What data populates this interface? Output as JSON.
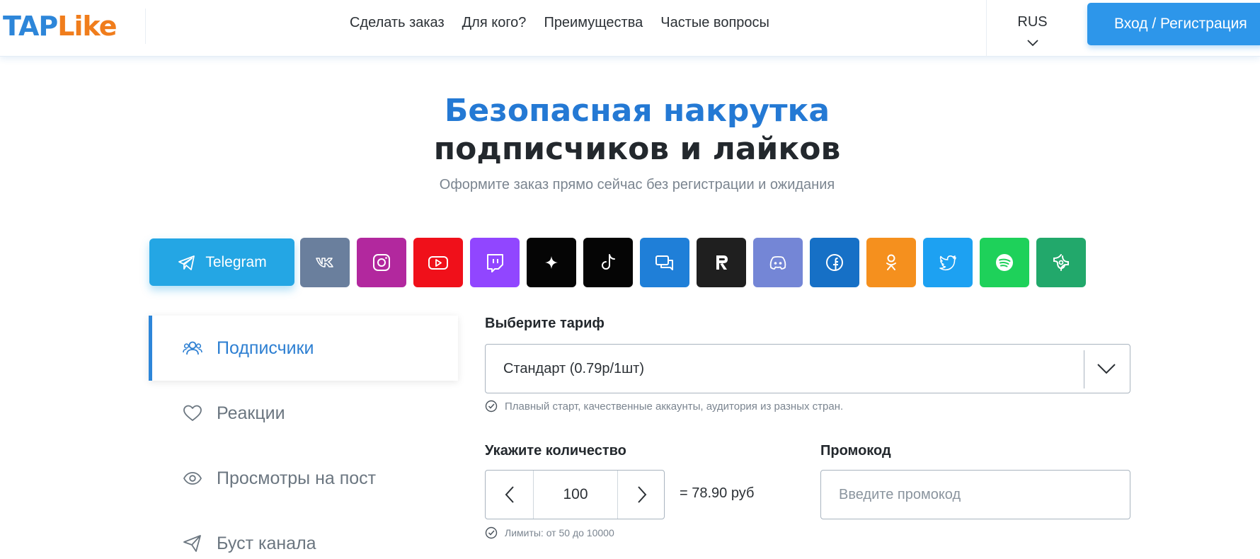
{
  "brand": {
    "part1": "TAP",
    "part2": "Like"
  },
  "nav": [
    {
      "label": "Сделать заказ"
    },
    {
      "label": "Для кого?"
    },
    {
      "label": "Преимущества"
    },
    {
      "label": "Частые вопросы"
    }
  ],
  "language": {
    "code": "RUS"
  },
  "login_button": "Вход / Регистрация",
  "hero": {
    "title_line1": "Безопасная накрутка",
    "title_line2": "подписчиков и лайков",
    "subtitle": "Оформите заказ прямо сейчас без регистрации и ожидания"
  },
  "platforms": [
    {
      "name": "Telegram",
      "icon": "telegram-icon",
      "color": "#24a6e4",
      "selected": true
    },
    {
      "name": "VK",
      "icon": "vk-icon",
      "color": "#6a7f9d"
    },
    {
      "name": "Instagram",
      "icon": "instagram-icon",
      "color": "#b2289e"
    },
    {
      "name": "YouTube",
      "icon": "youtube-icon",
      "color": "#f0101a"
    },
    {
      "name": "Twitch",
      "icon": "twitch-icon",
      "color": "#9146ff"
    },
    {
      "name": "Threads",
      "icon": "sparkle-icon",
      "color": "#050505"
    },
    {
      "name": "TikTok",
      "icon": "tiktok-icon",
      "color": "#050505"
    },
    {
      "name": "Chats",
      "icon": "chat-icon",
      "color": "#1f7fd8"
    },
    {
      "name": "Rutube",
      "icon": "rutube-icon",
      "color": "#1f1f1f"
    },
    {
      "name": "Discord",
      "icon": "discord-icon",
      "color": "#7486d6"
    },
    {
      "name": "Facebook",
      "icon": "facebook-icon",
      "color": "#1670c6"
    },
    {
      "name": "Odnoklassniki",
      "icon": "odnoklassniki-icon",
      "color": "#f5901e"
    },
    {
      "name": "Twitter",
      "icon": "twitter-icon",
      "color": "#1da1f2"
    },
    {
      "name": "Spotify",
      "icon": "spotify-icon",
      "color": "#1ed15a"
    },
    {
      "name": "Dzen",
      "icon": "dzen-icon",
      "color": "#22a86b"
    }
  ],
  "sidebar": [
    {
      "label": "Подписчики",
      "icon": "users-icon",
      "active": true
    },
    {
      "label": "Реакции",
      "icon": "heart-icon",
      "active": false
    },
    {
      "label": "Просмотры на пост",
      "icon": "eye-icon",
      "active": false
    },
    {
      "label": "Буст канала",
      "icon": "send-icon",
      "active": false
    }
  ],
  "form": {
    "tariff_label": "Выберите тариф",
    "tariff_value": "Стандарт (0.79р/1шт)",
    "tariff_hint": "Плавный старт, качественные аккаунты, аудитория из разных стран.",
    "quantity_label": "Укажите количество",
    "quantity_value": "100",
    "price_text": "= 78.90 руб",
    "limits_hint": "Лимиты: от 50 до 10000",
    "promo_label": "Промокод",
    "promo_placeholder": "Введите промокод"
  }
}
